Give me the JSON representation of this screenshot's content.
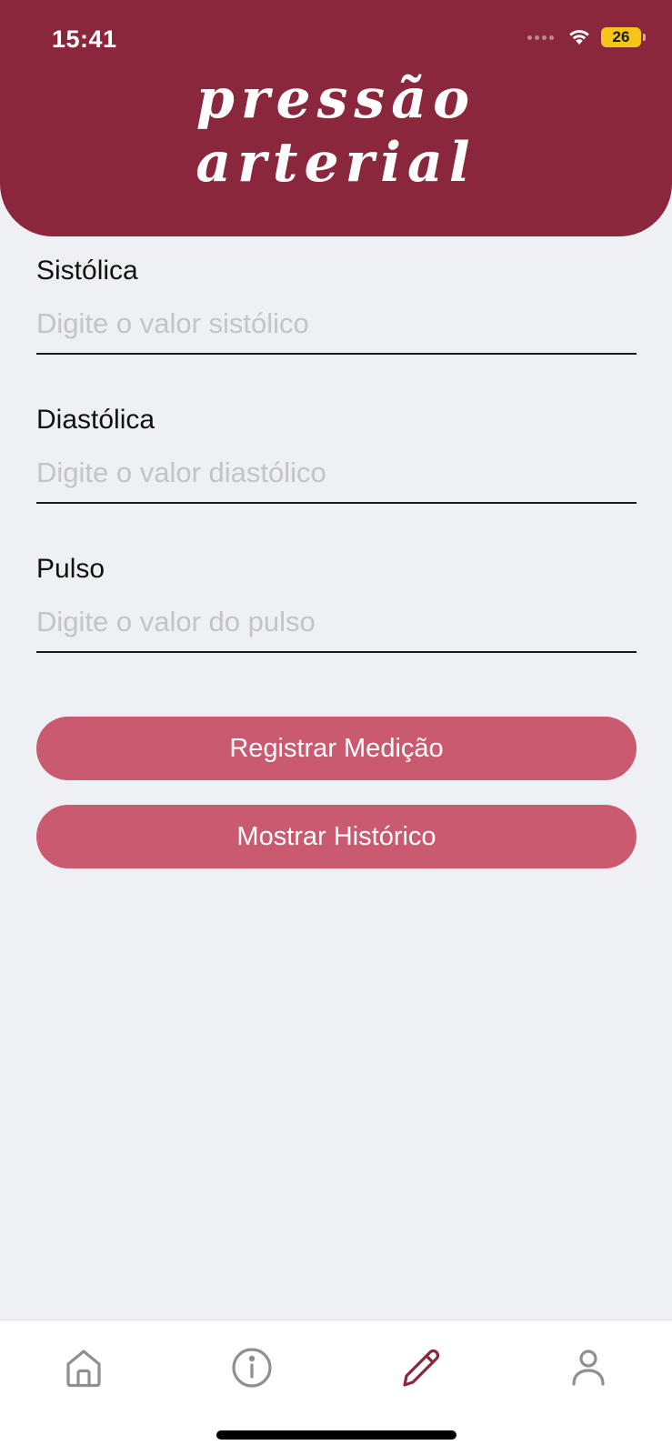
{
  "status_bar": {
    "time": "15:41",
    "battery_level": "26",
    "icons": [
      "signal-dots-icon",
      "wifi-icon",
      "battery-icon"
    ]
  },
  "header": {
    "title_line1": "pressão",
    "title_line2": "arterial",
    "color": "#8a273c"
  },
  "form": {
    "systolic": {
      "label": "Sistólica",
      "placeholder": "Digite o valor sistólico",
      "value": ""
    },
    "diastolic": {
      "label": "Diastólica",
      "placeholder": "Digite o valor diastólico",
      "value": ""
    },
    "pulse": {
      "label": "Pulso",
      "placeholder": "Digite o valor do pulso",
      "value": ""
    }
  },
  "buttons": {
    "register_label": "Registrar Medição",
    "history_label": "Mostrar Histórico",
    "color": "#ca5a70"
  },
  "tabbar": {
    "items": [
      {
        "icon": "home-icon",
        "active": false
      },
      {
        "icon": "info-icon",
        "active": false
      },
      {
        "icon": "pencil-icon",
        "active": true
      },
      {
        "icon": "person-icon",
        "active": false
      }
    ],
    "active_color": "#8a273c",
    "inactive_color": "#8e8e93"
  }
}
